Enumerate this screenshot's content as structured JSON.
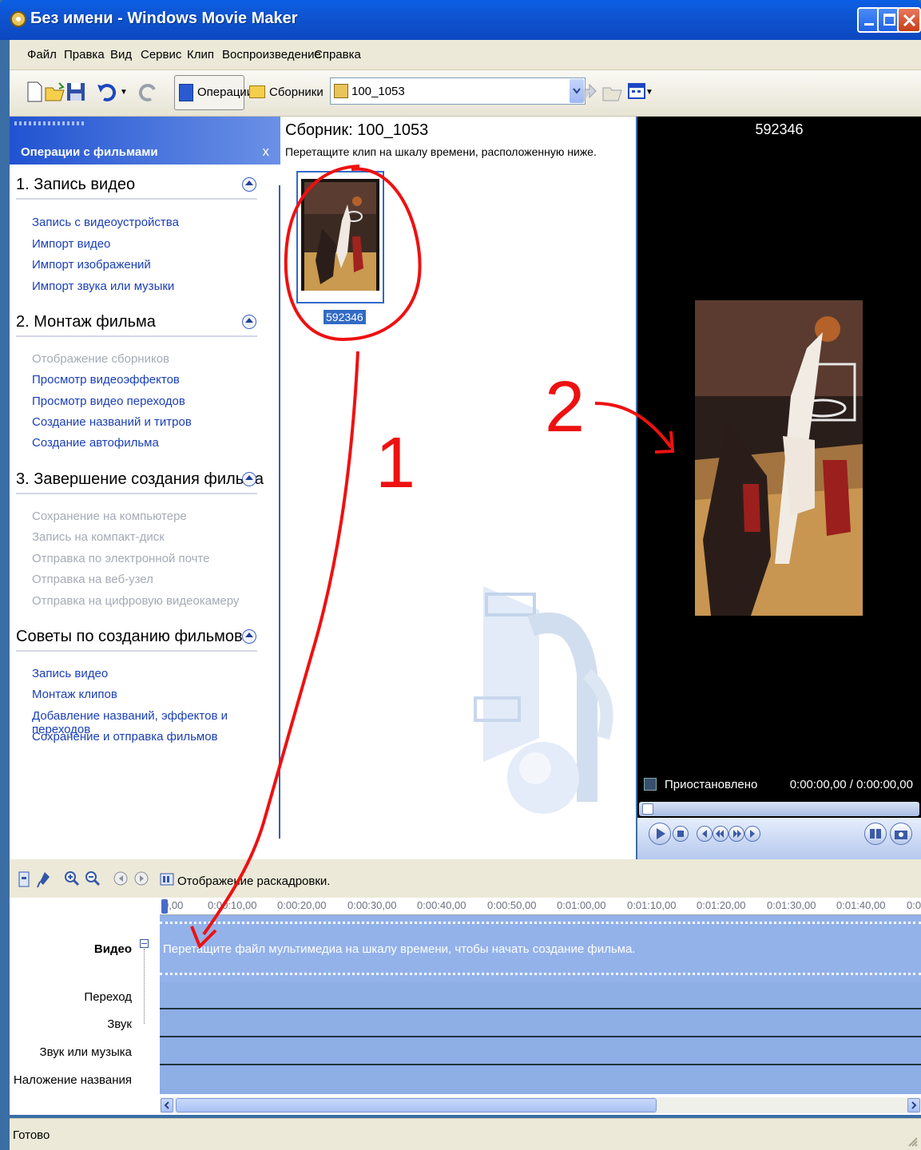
{
  "window": {
    "title": "Без имени - Windows Movie Maker"
  },
  "menu": [
    "Файл",
    "Правка",
    "Вид",
    "Сервис",
    "Клип",
    "Воспроизведение",
    "Справка"
  ],
  "toolbar": {
    "tasks_label": "Операции",
    "collections_label": "Сборники",
    "collection_selected": "100_1053"
  },
  "tasks": {
    "header": "Операции с фильмами",
    "close": "x",
    "sections": [
      {
        "title": "1. Запись видео",
        "links": [
          {
            "label": "Запись с видеоустройства",
            "enabled": true
          },
          {
            "label": "Импорт видео",
            "enabled": true
          },
          {
            "label": "Импорт изображений",
            "enabled": true
          },
          {
            "label": "Импорт звука или музыки",
            "enabled": true
          }
        ]
      },
      {
        "title": "2. Монтаж фильма",
        "links": [
          {
            "label": "Отображение сборников",
            "enabled": false
          },
          {
            "label": "Просмотр видеоэффектов",
            "enabled": true
          },
          {
            "label": "Просмотр видео переходов",
            "enabled": true
          },
          {
            "label": "Создание названий и титров",
            "enabled": true
          },
          {
            "label": "Создание автофильма",
            "enabled": true
          }
        ]
      },
      {
        "title": "3. Завершение создания фильма",
        "links": [
          {
            "label": "Сохранение на компьютере",
            "enabled": false
          },
          {
            "label": "Запись на компакт-диск",
            "enabled": false
          },
          {
            "label": "Отправка по электронной почте",
            "enabled": false
          },
          {
            "label": "Отправка на веб-узел",
            "enabled": false
          },
          {
            "label": "Отправка на цифровую видеокамеру",
            "enabled": false
          }
        ]
      },
      {
        "title": "Советы по созданию фильмов",
        "links": [
          {
            "label": "Запись видео",
            "enabled": true
          },
          {
            "label": "Монтаж клипов",
            "enabled": true
          },
          {
            "label": "Добавление названий, эффектов и переходов",
            "enabled": true
          },
          {
            "label": "Сохранение и отправка фильмов",
            "enabled": true
          }
        ]
      }
    ]
  },
  "collection": {
    "title": "Сборник: 100_1053",
    "hint": "Перетащите клип на шкалу времени, расположенную ниже.",
    "clip_label": "592346"
  },
  "preview": {
    "title": "592346",
    "status": "Приостановлено",
    "time": "0:00:00,00 / 0:00:00,00"
  },
  "storyboard": {
    "label": "Отображение раскадровки."
  },
  "timeline": {
    "ticks": [
      "0,00",
      "0:00:10,00",
      "0:00:20,00",
      "0:00:30,00",
      "0:00:40,00",
      "0:00:50,00",
      "0:01:00,00",
      "0:01:10,00",
      "0:01:20,00",
      "0:01:30,00",
      "0:01:40,00",
      "0:0"
    ],
    "tracks": [
      "Видео",
      "Переход",
      "Звук",
      "Звук или музыка",
      "Наложение названия"
    ],
    "drop_hint": "Перетащите файл мультимедиа на шкалу времени, чтобы начать создание фильма."
  },
  "status": "Готово",
  "annotations": {
    "one": "1",
    "two": "2"
  },
  "colors": {
    "title_blue": "#0a5fe6",
    "task_link": "#1a3fb7",
    "timeline_track": "#8eaee6",
    "annotation_red": "#ee1111"
  }
}
